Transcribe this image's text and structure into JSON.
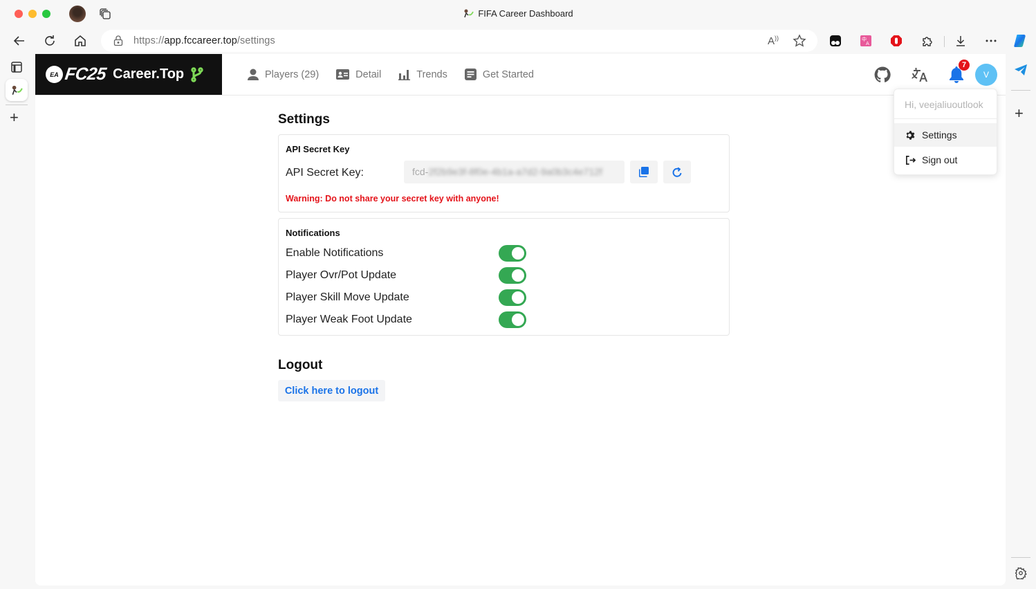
{
  "browser": {
    "window_title": "FIFA Career Dashboard",
    "url_prefix": "https://",
    "url_host": "app.fccareer.top",
    "url_path": "/settings",
    "read_aloud_label": "A⁾"
  },
  "app": {
    "brand_ea": "EA",
    "brand_fc": "FC25",
    "brand_name": "Career.Top",
    "nav": [
      {
        "label": "Players (29)",
        "icon": "person-icon"
      },
      {
        "label": "Detail",
        "icon": "id-card-icon"
      },
      {
        "label": "Trends",
        "icon": "bar-chart-icon"
      },
      {
        "label": "Get Started",
        "icon": "document-icon"
      }
    ],
    "notification_count": "7",
    "avatar_initial": "V"
  },
  "dropdown": {
    "greeting": "Hi, veejaliuoutlook",
    "items": [
      {
        "label": "Settings",
        "icon": "gear-icon",
        "active": true
      },
      {
        "label": "Sign out",
        "icon": "sign-out-icon",
        "active": false
      }
    ]
  },
  "settings": {
    "title": "Settings",
    "api": {
      "section_title": "API Secret Key",
      "label": "API Secret Key:",
      "key_prefix": "fcd-",
      "key_masked": "2f2b9e3f-8f0e-4b1a-a7d2-9a0b3c4e712f",
      "warning": "Warning: Do not share your secret key with anyone!"
    },
    "notifications": {
      "section_title": "Notifications",
      "items": [
        {
          "label": "Enable Notifications",
          "enabled": true
        },
        {
          "label": "Player Ovr/Pot Update",
          "enabled": true
        },
        {
          "label": "Player Skill Move Update",
          "enabled": true
        },
        {
          "label": "Player Weak Foot Update",
          "enabled": true
        }
      ]
    },
    "logout": {
      "title": "Logout",
      "button_label": "Click here to logout"
    }
  },
  "colors": {
    "toggle_on": "#34a853",
    "accent_blue": "#1a73e8",
    "warning_red": "#e4131a",
    "avatar_bg": "#5ec1f5",
    "brand_green": "#7ed957"
  }
}
